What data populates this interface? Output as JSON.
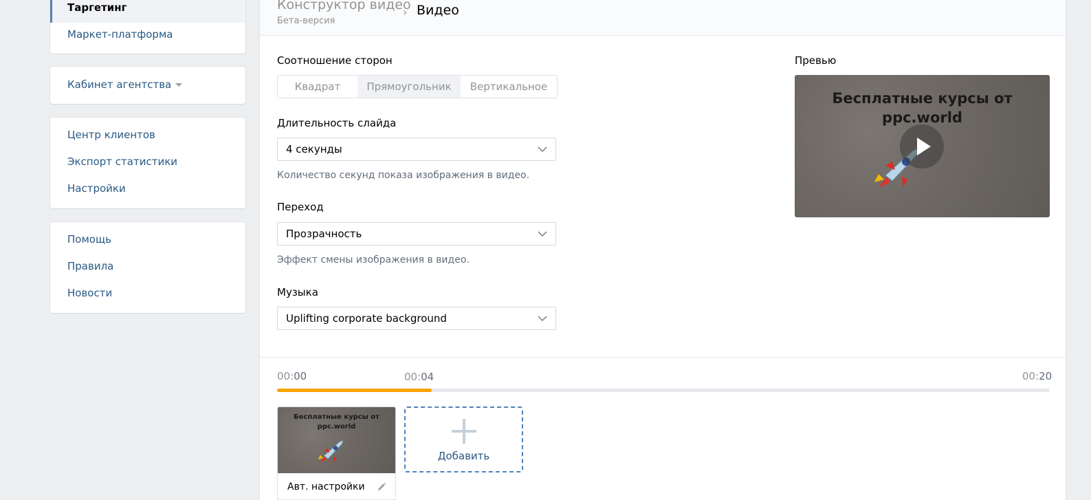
{
  "sidebar": {
    "active_item": "Таргетинг",
    "group1": [
      "Маркет-платформа"
    ],
    "group2": {
      "agency_cabinet": "Кабинет агентства"
    },
    "group3": [
      "Центр клиентов",
      "Экспорт статистики",
      "Настройки"
    ],
    "group4": [
      "Помощь",
      "Правила",
      "Новости"
    ]
  },
  "header": {
    "title": "Конструктор видео",
    "subtitle": "Бета-версия",
    "separator": "›",
    "current": "Видео"
  },
  "form": {
    "aspect_label": "Соотношение сторон",
    "aspect_options": [
      "Квадрат",
      "Прямоугольник",
      "Вертикальное"
    ],
    "aspect_selected": "Прямоугольник",
    "duration_label": "Длительность слайда",
    "duration_value": "4 секунды",
    "duration_hint": "Количество секунд показа изображения в видео.",
    "transition_label": "Переход",
    "transition_value": "Прозрачность",
    "transition_hint": "Эффект смены изображения в видео.",
    "music_label": "Музыка",
    "music_value": "Uplifting corporate background"
  },
  "preview": {
    "label": "Превью",
    "image_text_line1": "Бесплатные курсы от",
    "image_text_line2": "ppc.world"
  },
  "timeline": {
    "start": {
      "pre": "00:",
      "num": "00"
    },
    "marker": {
      "pre": "00:",
      "num": "04"
    },
    "end": {
      "pre": "00:",
      "num": "20"
    },
    "progress_fraction": 0.2
  },
  "slides": [
    {
      "text_line1": "Бесплатные курсы от",
      "text_line2": "ppc.world",
      "caption": "Авт. настройки"
    }
  ],
  "add_button": {
    "label": "Добавить"
  },
  "colors": {
    "link": "#2a5885",
    "accent": "#5181b8",
    "progress": "#f8a300"
  }
}
